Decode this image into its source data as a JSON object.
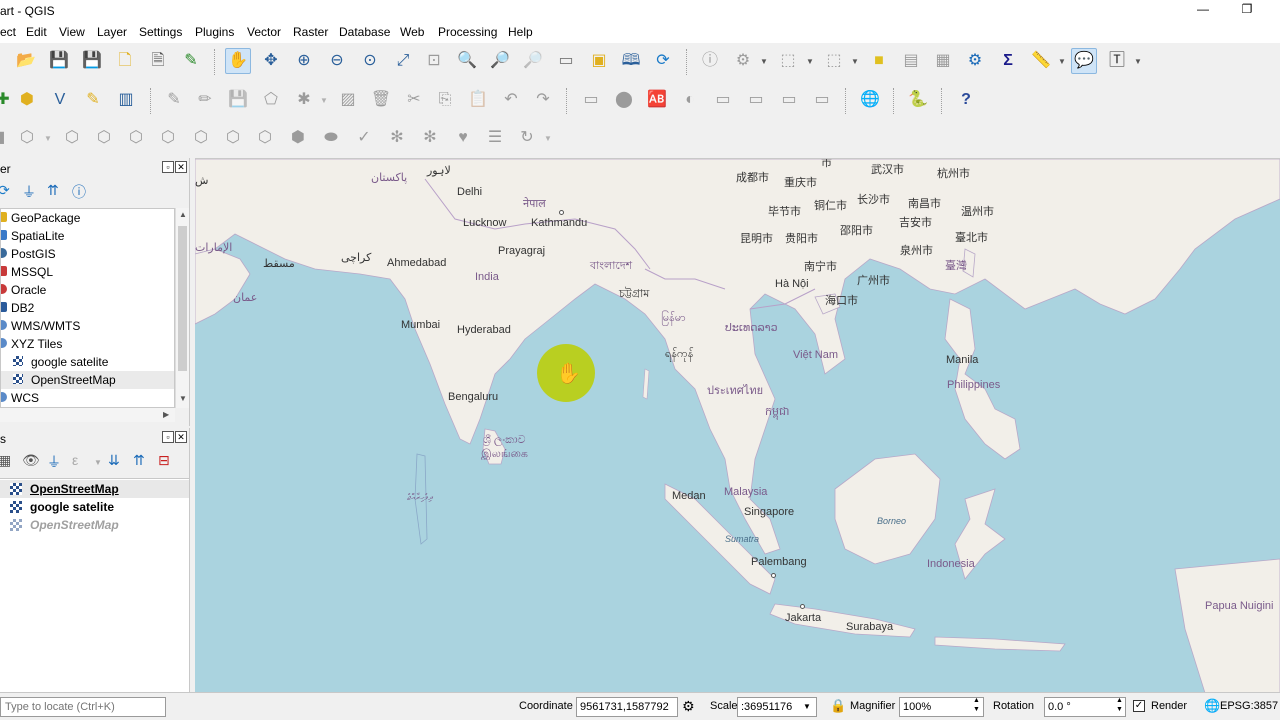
{
  "window": {
    "title": "art - QGIS",
    "minimize": "—",
    "restore": "❐"
  },
  "menu": [
    "ect",
    "Edit",
    "View",
    "Layer",
    "Settings",
    "Plugins",
    "Vector",
    "Raster",
    "Database",
    "Web",
    "Processing",
    "Help"
  ],
  "browser_panel": {
    "title": "er",
    "items": [
      {
        "label": "GeoPackage"
      },
      {
        "label": "SpatiaLite"
      },
      {
        "label": "PostGIS"
      },
      {
        "label": "MSSQL"
      },
      {
        "label": "Oracle"
      },
      {
        "label": "DB2"
      },
      {
        "label": "WMS/WMTS"
      },
      {
        "label": "XYZ Tiles"
      },
      {
        "label": "google satelite"
      },
      {
        "label": "OpenStreetMap"
      },
      {
        "label": "WCS"
      }
    ]
  },
  "layers_panel": {
    "title": "s",
    "layers": [
      {
        "label": "OpenStreetMap",
        "state": "active"
      },
      {
        "label": "google satelite",
        "state": "visible"
      },
      {
        "label": "OpenStreetMap",
        "state": "hidden"
      }
    ]
  },
  "map": {
    "labels": {
      "pakistan": "پاکستان",
      "lahore": "لاہور",
      "delhi": "Delhi",
      "nepal": "नेपाल",
      "lucknow": "Lucknow",
      "kathmandu": "Kathmandu",
      "karachi": "کراچی",
      "ahmedabad": "Ahmedabad",
      "prayagraj": "Prayagraj",
      "bangladesh": "বাংলাদেশ",
      "india": "India",
      "chittagong": "চট্টগ্রাম",
      "mumbai": "Mumbai",
      "hyderabad": "Hyderabad",
      "muscat": "مسقط",
      "oman": "عمان",
      "uae": "الإمارات",
      "bengaluru": "Bengaluru",
      "srilanka": "ශ්‍රී ලංකාව",
      "srilanka_ta": "இலங்கை",
      "maldives": "ދިވެހިރާއްޖެ",
      "myanmar": "မြန်မာ",
      "yangon": "ရန်ကုန်",
      "laos": "ປະເທດລາວ",
      "thailand": "ประเทศไทย",
      "cambodia": "កម្ពុជា",
      "vietnam": "Việt Nam",
      "hanoi": "Hà Nội",
      "haikou": "海口市",
      "nanning": "南宁市",
      "guangzhou": "广州市",
      "kunming": "昆明市",
      "guiyang": "贵阳市",
      "bijie": "毕节市",
      "tongren": "铜仁市",
      "shaoyang": "邵阳市",
      "chengdu": "成都市",
      "chongqing": "重庆市",
      "changsha": "长沙市",
      "wuhan": "武汉市",
      "hangzhou": "杭州市",
      "nanchang": "南昌市",
      "jian": "吉安市",
      "quanzhou": "泉州市",
      "wenzhou": "温州市",
      "taipei": "臺北市",
      "taiwan": "臺灣",
      "chinatop": "市",
      "manila": "Manila",
      "philippines": "Philippines",
      "medan": "Medan",
      "malaysia": "Malaysia",
      "singapore": "Singapore",
      "sumatra": "Sumatra",
      "borneo": "Borneo",
      "palembang": "Palembang",
      "indonesia": "Indonesia",
      "jakarta": "Jakarta",
      "surabaya": "Surabaya",
      "papua": "Papua Nuigini",
      "leftedge": "ش"
    }
  },
  "statusbar": {
    "locator_placeholder": "Type to locate (Ctrl+K)",
    "coordinate_label": "Coordinate",
    "coordinate_value": "9561731,1587792",
    "scale_label": "Scale",
    "scale_value": ":36951176",
    "magnifier_label": "Magnifier",
    "magnifier_value": "100%",
    "rotation_label": "Rotation",
    "rotation_value": "0.0 °",
    "render_label": "Render",
    "crs": "EPSG:3857"
  }
}
